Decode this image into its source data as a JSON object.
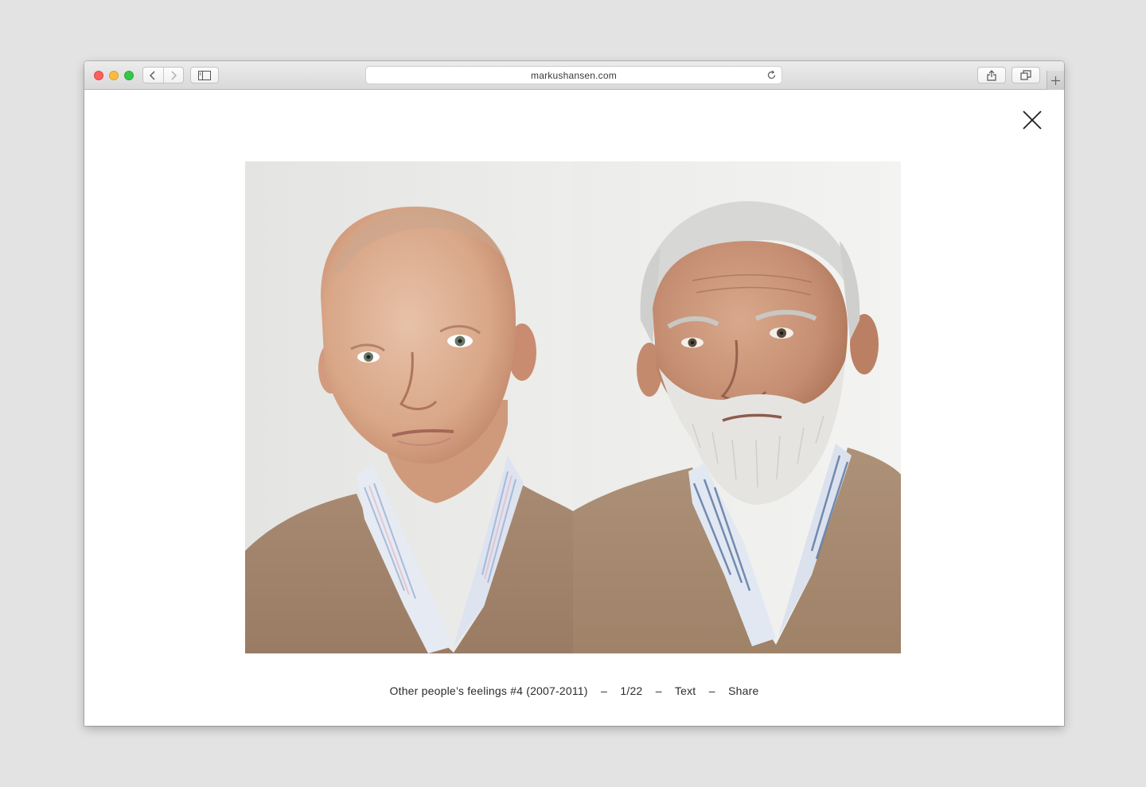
{
  "browser": {
    "url": "markushansen.com"
  },
  "gallery": {
    "images": [
      {
        "alt": "portrait-left"
      },
      {
        "alt": "portrait-right"
      }
    ],
    "caption": {
      "title": "Other people’s feelings #4 (2007-2011)",
      "separator": "–",
      "counter": "1/22",
      "text_link": "Text",
      "share_link": "Share"
    }
  }
}
